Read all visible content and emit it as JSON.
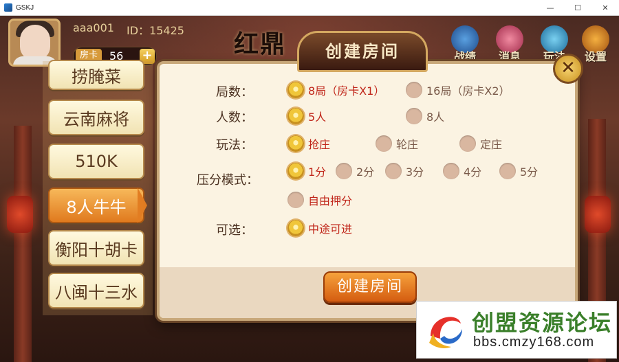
{
  "window": {
    "title": "GSKJ",
    "buttons": [
      "—",
      "☐",
      "✕"
    ]
  },
  "user": {
    "name": "aaa001",
    "id_text": "ID：15425",
    "room_card_label": "房卡",
    "room_card_count": "56",
    "add_symbol": "+"
  },
  "logo": {
    "text": "红鼎"
  },
  "topnav": [
    {
      "label": "战绩",
      "icon": "record-icon"
    },
    {
      "label": "消息",
      "icon": "message-icon"
    },
    {
      "label": "玩法",
      "icon": "rules-icon"
    },
    {
      "label": "设置",
      "icon": "settings-icon"
    }
  ],
  "games": [
    "捞腌菜",
    "云南麻将",
    "510K",
    "8人牛牛",
    "衡阳十胡卡",
    "八闽十三水"
  ],
  "active_game": "8人牛牛",
  "dialog": {
    "title": "创建房间",
    "close_symbol": "✕",
    "rows": {
      "rounds": {
        "label": "局数：",
        "options": [
          "8局（房卡X1）",
          "16局（房卡X2）"
        ],
        "selected": 0
      },
      "players": {
        "label": "人数：",
        "options": [
          "5人",
          "8人"
        ],
        "selected": 0
      },
      "mode": {
        "label": "玩法：",
        "options": [
          "抢庄",
          "轮庄",
          "定庄"
        ],
        "selected": 0
      },
      "score": {
        "label": "压分模式：",
        "options": [
          "1分",
          "2分",
          "3分",
          "4分",
          "5分",
          "自由押分"
        ],
        "selected": 0
      },
      "optional": {
        "label": "可选：",
        "options": [
          "中途可进"
        ],
        "selected": 0
      }
    },
    "create_button": "创建房间"
  },
  "watermark": {
    "title": "创盟资源论坛",
    "url": "bbs.cmzy168.com"
  },
  "colors": {
    "accent": "#e07a1e",
    "selected_text": "#c0261a",
    "dialog_bg": "#fbf3e2"
  }
}
